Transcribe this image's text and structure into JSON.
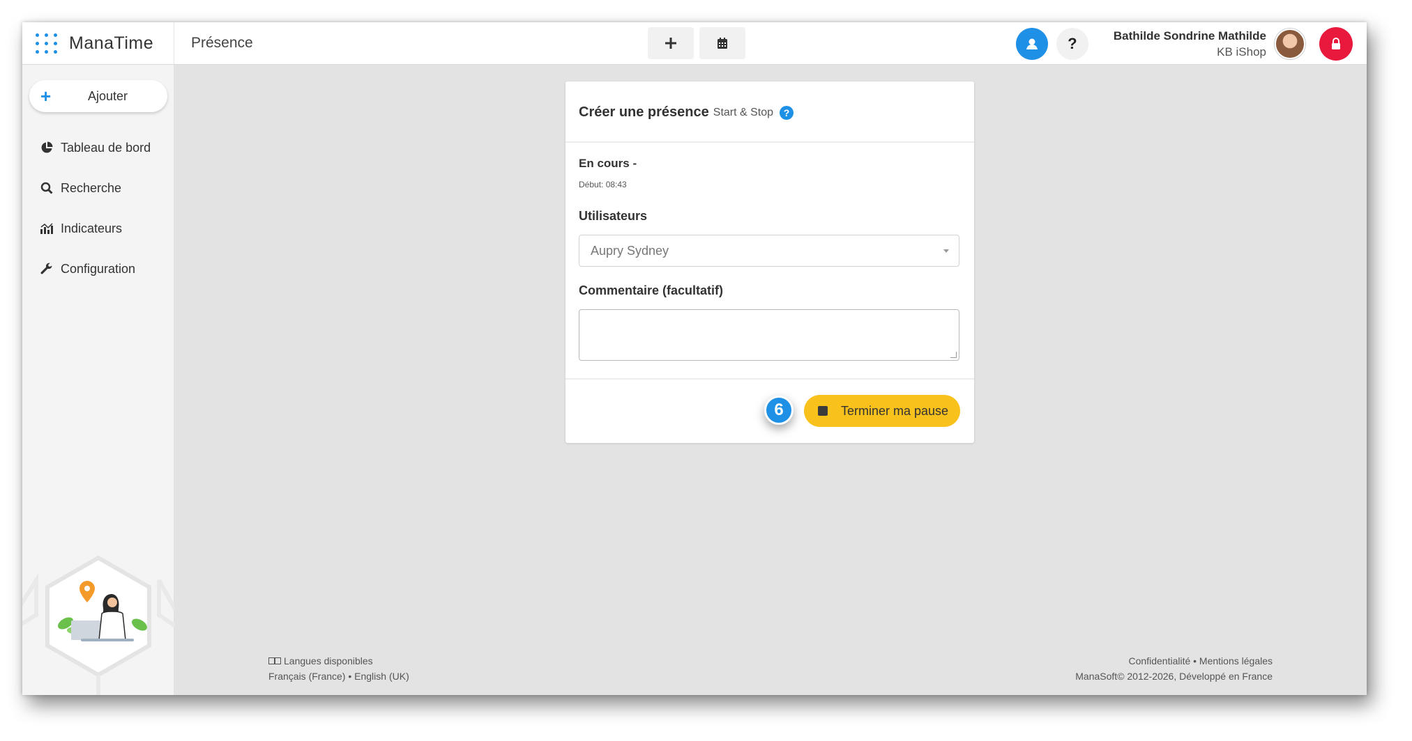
{
  "app": {
    "brand": "ManaTime",
    "page_title": "Présence"
  },
  "topbar": {
    "add_icon": "plus-icon",
    "calendar_icon": "calendar-icon",
    "profile_icon": "user-icon",
    "help_label": "?",
    "user_name": "Bathilde Sondrine Mathilde",
    "user_org": "KB iShop",
    "logout_icon": "lock-icon"
  },
  "sidebar": {
    "add_label": "Ajouter",
    "items": [
      {
        "label": "Tableau de bord",
        "icon": "pie-chart-icon"
      },
      {
        "label": "Recherche",
        "icon": "search-icon"
      },
      {
        "label": "Indicateurs",
        "icon": "chart-icon"
      },
      {
        "label": "Configuration",
        "icon": "wrench-icon"
      }
    ]
  },
  "card": {
    "title": "Créer une présence",
    "subtitle": "Start & Stop",
    "status": "En cours -",
    "start_time": "Début: 08:43",
    "users_label": "Utilisateurs",
    "users_value": "Aupry Sydney",
    "comment_label": "Commentaire (facultatif)",
    "comment_value": "",
    "step_number": "6",
    "end_button": "Terminer ma pause"
  },
  "footer": {
    "languages_title": "Langues disponibles",
    "languages": "Français (France) • English (UK)",
    "links": "Confidentialité • Mentions légales",
    "copyright": "ManaSoft© 2012-2026, Développé en France"
  },
  "colors": {
    "accent_blue": "#1e90e6",
    "button_yellow": "#f8c11c",
    "logout_red": "#e8193c"
  }
}
